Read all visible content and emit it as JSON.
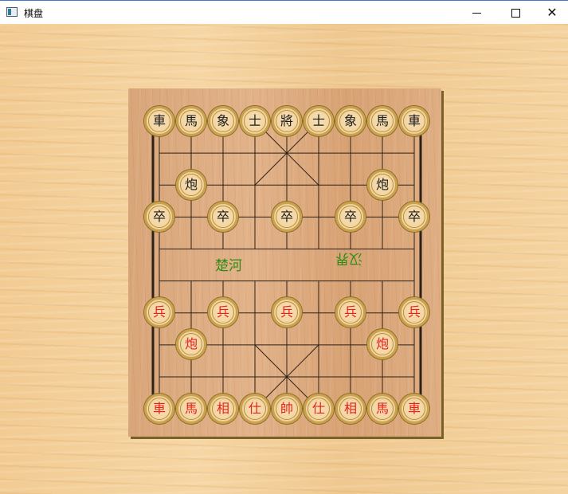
{
  "window": {
    "title": "棋盘"
  },
  "river": {
    "left": "楚河",
    "right": "汉界"
  },
  "pieces": {
    "black_back": [
      "車",
      "馬",
      "象",
      "士",
      "將",
      "士",
      "象",
      "馬",
      "車"
    ],
    "black_cannon_l": "炮",
    "black_cannon_r": "炮",
    "black_soldiers": [
      "卒",
      "卒",
      "卒",
      "卒",
      "卒"
    ],
    "red_soldiers": [
      "兵",
      "兵",
      "兵",
      "兵",
      "兵"
    ],
    "red_cannon_l": "炮",
    "red_cannon_r": "炮",
    "red_back": [
      "車",
      "馬",
      "相",
      "仕",
      "帥",
      "仕",
      "相",
      "馬",
      "車"
    ]
  },
  "colors": {
    "red_piece": "#e8201a",
    "black_piece": "#1a1a1a",
    "river_text": "#2e8b14"
  }
}
